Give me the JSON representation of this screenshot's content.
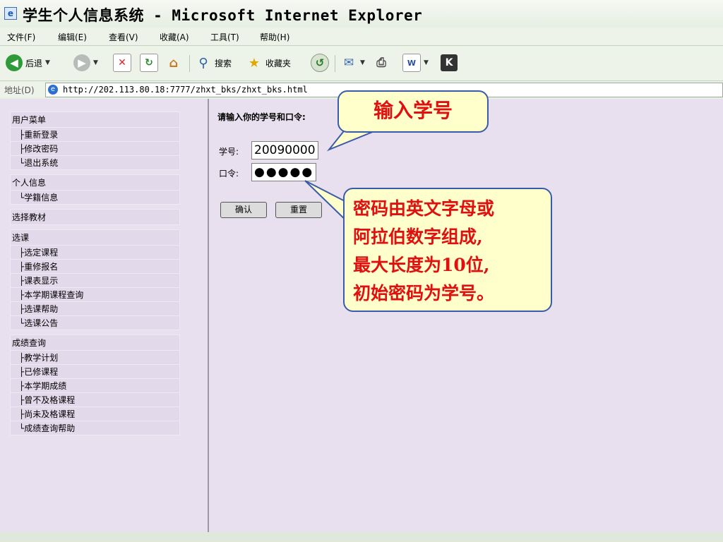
{
  "window": {
    "title": "学生个人信息系统 - Microsoft Internet Explorer"
  },
  "menubar": [
    "文件(F)",
    "编辑(E)",
    "查看(V)",
    "收藏(A)",
    "工具(T)",
    "帮助(H)"
  ],
  "toolbar": {
    "back_label": "后退",
    "search_label": "搜索",
    "favorites_label": "收藏夹"
  },
  "address": {
    "label": "地址(D)",
    "url": "http://202.113.80.18:7777/zhxt_bks/zhxt_bks.html"
  },
  "sidebar": {
    "title": "用户菜单",
    "sections": [
      {
        "head": "用户菜单",
        "items": [
          "├重新登录",
          "├修改密码",
          "└退出系统"
        ]
      },
      {
        "head": "个人信息",
        "items": [
          "└学籍信息"
        ]
      },
      {
        "head": "选择教材",
        "items": []
      },
      {
        "head": "选课",
        "items": [
          "├选定课程",
          "├重修报名",
          "├课表显示",
          "├本学期课程查询",
          "├选课帮助",
          "└选课公告"
        ]
      },
      {
        "head": "成绩查询",
        "items": [
          "├教学计划",
          "├已修课程",
          "├本学期成绩",
          "├曾不及格课程",
          "├尚未及格课程",
          "└成绩查询帮助"
        ]
      }
    ]
  },
  "login": {
    "prompt": "请输入你的学号和口令:",
    "id_label": "学号:",
    "id_value": "20090000",
    "pwd_label": "口令:",
    "pwd_value": "●●●●●",
    "confirm_label": "确认",
    "reset_label": "重置"
  },
  "callouts": {
    "id_note": "输入学号",
    "pwd_note_lines": [
      "密码由英文字母或",
      "阿拉伯数字组成,",
      "最大长度为10位,",
      "初始密码为学号。"
    ]
  },
  "colors": {
    "pane_bg": "#e8e0ef",
    "callout_text": "#e01010",
    "callout_bg": "#ffffcc",
    "callout_border": "#3a5ca8"
  }
}
